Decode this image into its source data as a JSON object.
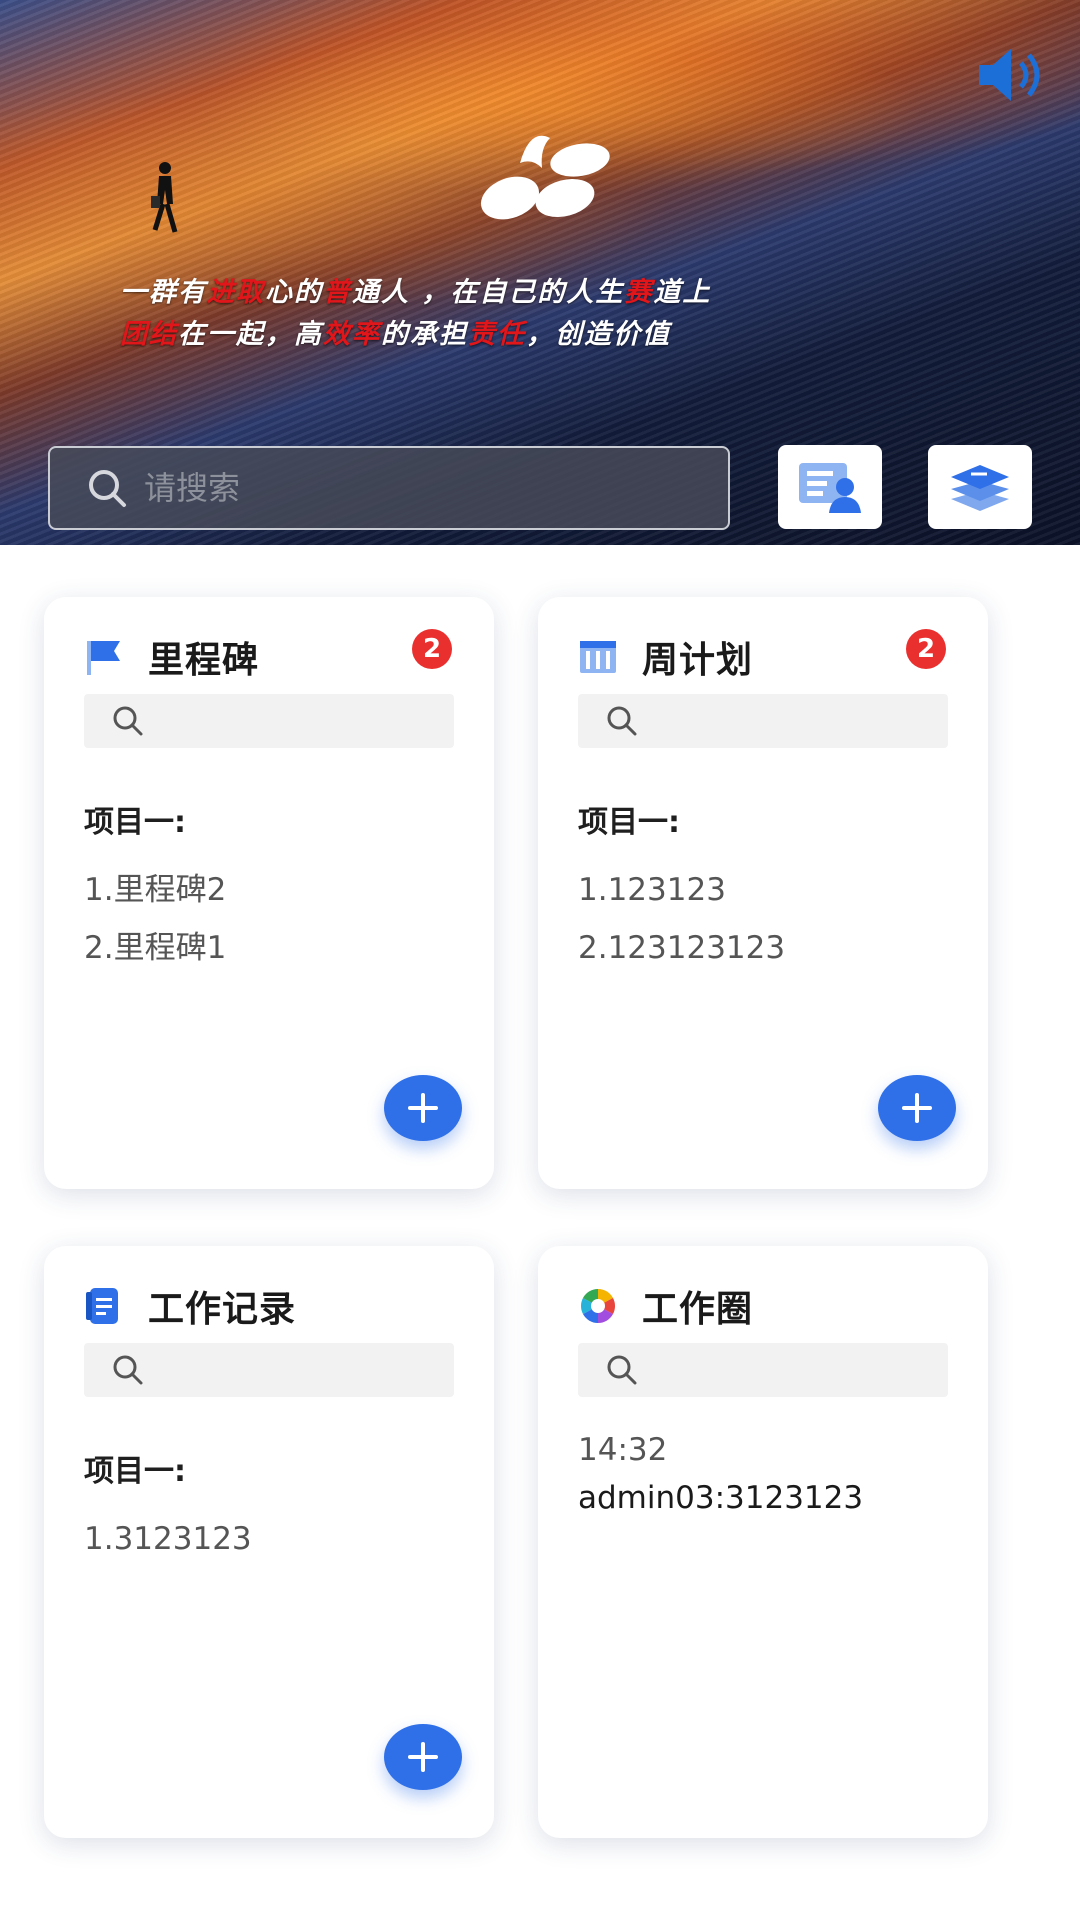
{
  "banner": {
    "slogan_line1": [
      "一群有",
      "进取",
      "心的",
      "普",
      "通人 ，在自己的人生",
      "赛",
      "道上"
    ],
    "slogan_line2": [
      "团结",
      "在一起，高",
      "效率",
      "的承担",
      "责任",
      "，创造价值"
    ]
  },
  "search": {
    "placeholder": "请搜索"
  },
  "toolbar": {
    "user_icon": "user-card-icon",
    "layers_icon": "layers-icon"
  },
  "cards": [
    {
      "title": "里程碑",
      "icon": "flag-icon",
      "badge": "2",
      "project": "项目一:",
      "items": [
        "1.里程碑2",
        "2.里程碑1"
      ]
    },
    {
      "title": "周计划",
      "icon": "calendar-grid-icon",
      "badge": "2",
      "project": "项目一:",
      "items": [
        "1.123123",
        "2.123123123"
      ]
    },
    {
      "title": "工作记录",
      "icon": "document-icon",
      "project": "项目一:",
      "items": [
        "1.3123123"
      ]
    },
    {
      "title": "工作圈",
      "icon": "camera-aperture-icon",
      "time": "14:32",
      "message": "admin03:3123123"
    }
  ],
  "colors": {
    "accent": "#2f6fe8",
    "badge": "#ea2f2f",
    "slogan_red": "#e0161b"
  }
}
